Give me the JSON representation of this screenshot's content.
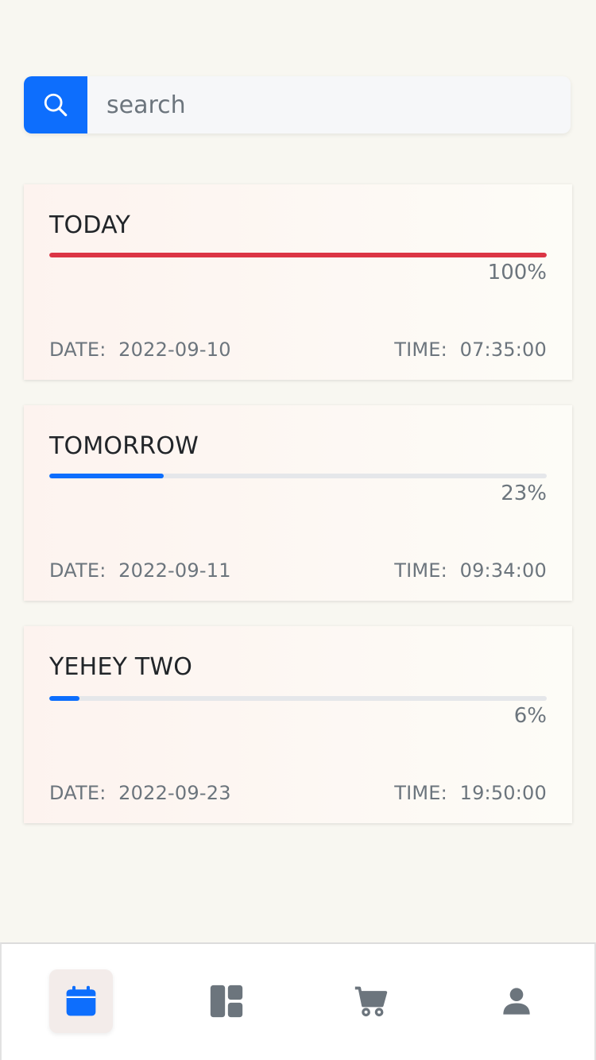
{
  "search": {
    "placeholder": "search"
  },
  "tasks": [
    {
      "title": "TODAY",
      "progress_pct": 100,
      "progress_label": "100%",
      "bar_color": "#dc3545",
      "date_label": "DATE:  2022-09-10",
      "time_label": "TIME:  07:35:00"
    },
    {
      "title": "TOMORROW",
      "progress_pct": 23,
      "progress_label": "23%",
      "bar_color": "#0d6efd",
      "date_label": "DATE:  2022-09-11",
      "time_label": "TIME:  09:34:00"
    },
    {
      "title": "YEHEY TWO",
      "progress_pct": 6,
      "progress_label": "6%",
      "bar_color": "#0d6efd",
      "date_label": "DATE:  2022-09-23",
      "time_label": "TIME:  19:50:00"
    }
  ],
  "nav": {
    "items": [
      {
        "icon": "calendar-icon",
        "active": true
      },
      {
        "icon": "dashboard-icon",
        "active": false
      },
      {
        "icon": "cart-icon",
        "active": false
      },
      {
        "icon": "user-icon",
        "active": false
      }
    ]
  },
  "colors": {
    "accent": "#0d6efd",
    "danger": "#dc3545",
    "icon_inactive": "#6c757d"
  }
}
